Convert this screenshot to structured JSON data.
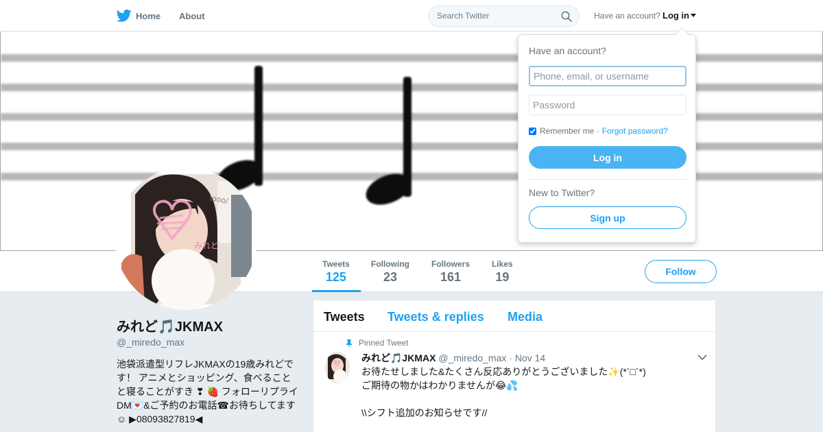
{
  "nav": {
    "home_label": "Home",
    "about_label": "About",
    "search_placeholder": "Search Twitter",
    "have_account": "Have an account?",
    "login_label": "Log in"
  },
  "profile": {
    "name": "みれど🎵JKMAX",
    "handle": "@_miredo_max",
    "bio": "池袋派遣型リフレJKMAXの19歳みれどです！ アニメとショッピング、食べることと寝ることがすき ❣ 🍓 フォローリプライDM💌&ご予約のお電話☎お待ちしてます☺ ▶08093827819◀",
    "avatar_overlay_text": "\\ooo/",
    "avatar_signature": "みれど"
  },
  "stats": [
    {
      "label": "Tweets",
      "value": "125"
    },
    {
      "label": "Following",
      "value": "23"
    },
    {
      "label": "Followers",
      "value": "161"
    },
    {
      "label": "Likes",
      "value": "19"
    }
  ],
  "follow_label": "Follow",
  "timeline": {
    "tabs": [
      "Tweets",
      "Tweets & replies",
      "Media"
    ],
    "pinned_label": "Pinned Tweet",
    "tweet": {
      "name": "みれど🎵JKMAX",
      "handle": "@_miredo_max",
      "date": "· Nov 14",
      "text": "お待たせしました&たくさん反応ありがとうございました✨(*´□`*)\nご期待の物かはわかりませんが😂💦\n\n\\\\シフト追加のお知らせです//"
    }
  },
  "login_dropdown": {
    "title": "Have an account?",
    "username_placeholder": "Phone, email, or username",
    "password_placeholder": "Password",
    "remember_label": "Remember me ·",
    "forgot_label": "Forgot password?",
    "login_button": "Log in",
    "new_label": "New to Twitter?",
    "signup_button": "Sign up"
  },
  "colors": {
    "accent": "#1da1f2",
    "login_button": "#4ab3f4",
    "background": "#e6ecf0"
  }
}
